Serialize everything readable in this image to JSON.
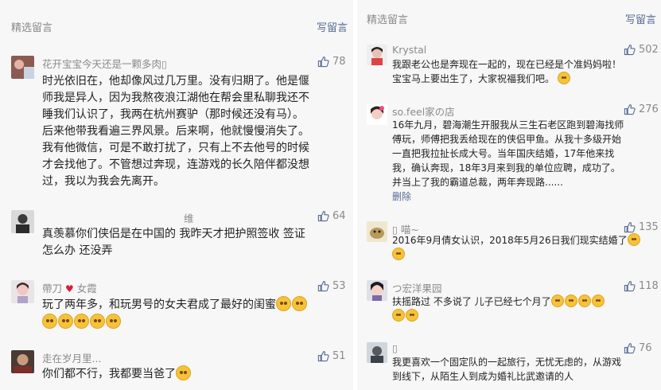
{
  "colors": {
    "link": "#576b95",
    "meta": "#8a8a8a",
    "heart": "#d81e3a",
    "panel_bg": "#f7f7f7"
  },
  "left": {
    "title": "精选留言",
    "write_label": "写留言",
    "comments": [
      {
        "nick": "花开宝宝今天还是一颗多肉▯",
        "likes": "78",
        "lines": [
          "时光依旧在，他却像风过几万里。没有归期了。他是偃",
          "师我是异人，因为我熬夜浪江湖他在帮会里私聊我还不",
          "睡我们认识了，我两在杭州赛驴（那时候还没有马）。",
          "后来他带我看遍三界风景。后来啊，他就慢慢消失了。",
          "我有他微信，可是不敢打扰了，只有上不去他号的时候",
          "才会找他了。不管想过奔现，连游戏的长久陪伴都没想",
          "过，我以为我会先离开。"
        ]
      },
      {
        "nick": "维",
        "likes": "64",
        "lines": [
          "真羡慕你们侠侣是在中国的  我昨天才把护照签收  签证",
          "怎么办  还没弄"
        ]
      },
      {
        "nick_a": "帶刀",
        "nick_b": "女霞",
        "likes": "53",
        "line1": "玩了两年多，和玩男号的女夫君成了最好的闺蜜"
      },
      {
        "nick": "走在岁月里...",
        "likes": "51",
        "line1": "你们都不行，我都要当爸了"
      }
    ]
  },
  "right": {
    "title": "精选留言",
    "write_label": "写留言",
    "comments": [
      {
        "nick": "Krystal",
        "likes": "502",
        "lines": [
          "我跟老公也是奔现在一起的，现在已经是个准妈妈啦！",
          "宝宝马上要出生了，大家祝福我们吧。"
        ]
      },
      {
        "nick": "so.feel家の店",
        "likes": "276",
        "lines": [
          "16年九月，碧海潮生开服我从三生石老区跑到碧海找师",
          "傅玩，师傅把我丢给现在的侠侣甲鱼。从我十多级开始",
          "一直把我拉扯长成大号。当年国庆结婚，17年他来找",
          "我，确认奔现，18年3月来到我的单位应聘，成功了。",
          "并当上了我的霸道总裁，两年奔现路......"
        ],
        "delete_label": "删除"
      },
      {
        "nick": "▯ 喵~",
        "likes": "135",
        "line1": "2016年9月倩女认识，2018年5月26日我们现实结婚了"
      },
      {
        "nick": "つ宏洋果园",
        "likes": "118",
        "line1": "扶摇路过      不多说了  儿子已经七个月了"
      },
      {
        "nick": "▯",
        "likes": "76",
        "lines": [
          "我更喜欢一个固定队的一起旅行，无忧无虑的，从游戏",
          "到线下，从陌生人到成为婚礼比武邀请的人"
        ]
      }
    ]
  }
}
